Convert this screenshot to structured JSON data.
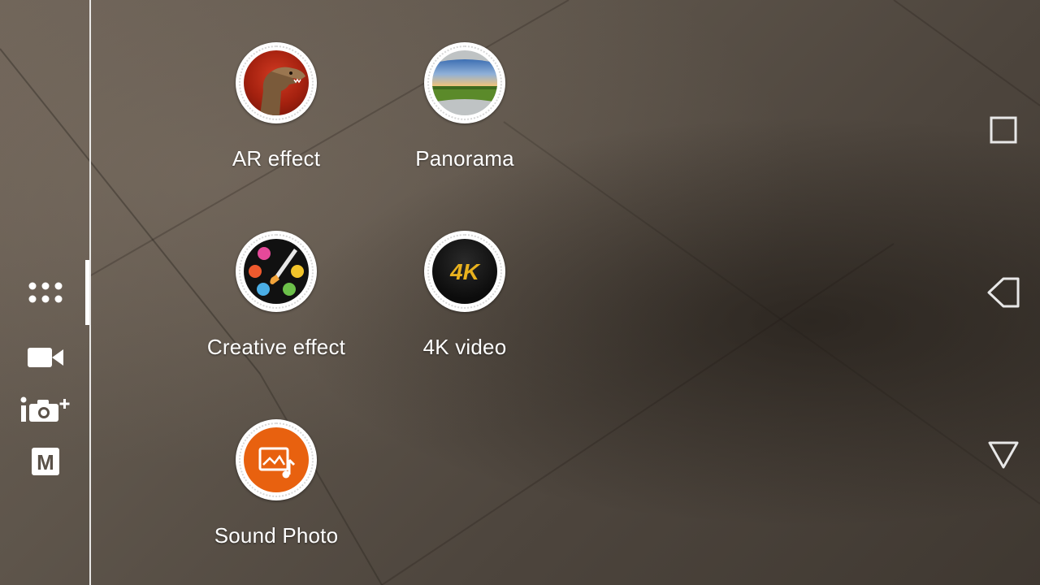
{
  "modes": [
    {
      "label": "AR effect",
      "icon": "dinosaur-icon"
    },
    {
      "label": "Panorama",
      "icon": "panorama-landscape-icon"
    },
    {
      "label": "Creative effect",
      "icon": "palette-brush-icon"
    },
    {
      "label": "4K video",
      "icon": "4k-badge-icon",
      "badge_text": "4K"
    },
    {
      "label": "Sound Photo",
      "icon": "image-music-icon"
    }
  ],
  "side_rail": {
    "items": [
      {
        "name": "camera-apps-grid",
        "icon": "grid-dots-icon",
        "selected": true
      },
      {
        "name": "video-mode",
        "icon": "video-camera-icon"
      },
      {
        "name": "superior-auto",
        "icon": "camera-plus-icon"
      },
      {
        "name": "manual-mode",
        "icon": "manual-m-icon",
        "text": "M"
      }
    ]
  },
  "nav_bar": {
    "items": [
      {
        "name": "recents",
        "icon": "square-icon"
      },
      {
        "name": "back",
        "icon": "back-triangle-icon"
      },
      {
        "name": "home",
        "icon": "down-triangle-icon"
      }
    ]
  },
  "colors": {
    "accent_orange": "#e8610f",
    "indicator": "#ffffff",
    "label_text": "#ffffff"
  }
}
